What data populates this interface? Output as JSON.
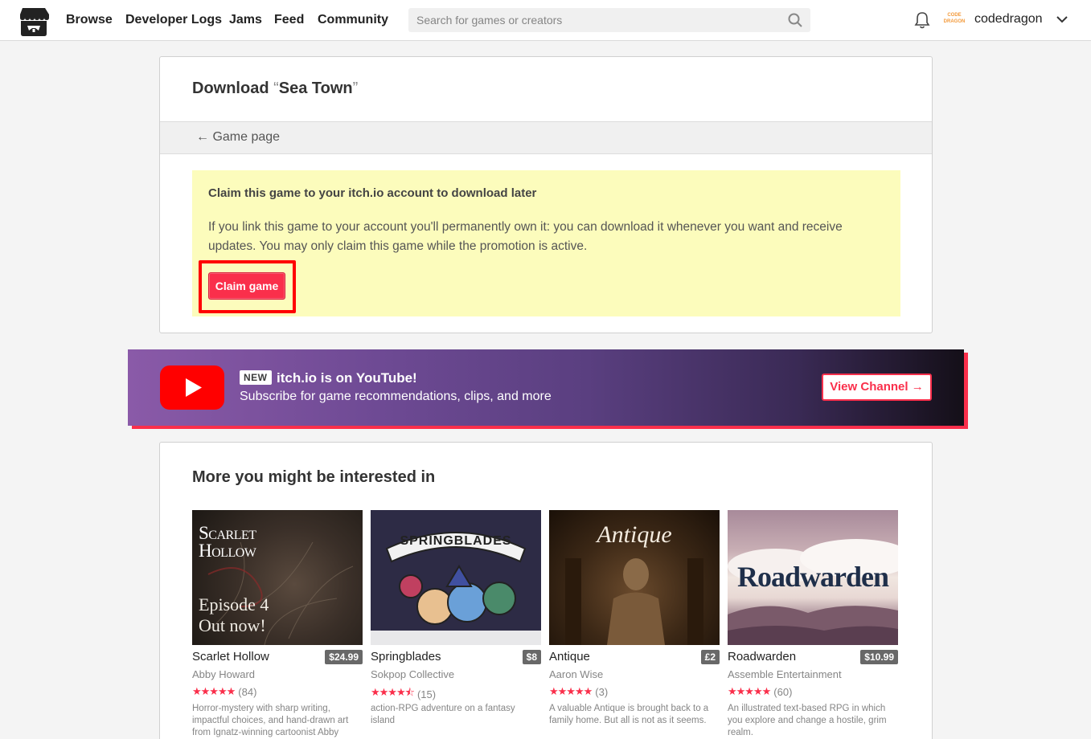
{
  "header": {
    "nav": [
      "Browse",
      "Developer Logs",
      "Jams",
      "Feed",
      "Community"
    ],
    "search_placeholder": "Search for games or creators",
    "avatar_text": "CODE DRAGON",
    "username": "codedragon"
  },
  "download": {
    "title_prefix": "Download ",
    "open_quote": "“",
    "game_name": "Sea Town",
    "close_quote": "”",
    "back_link": "← Game page",
    "claim_title": "Claim this game to your itch.io account to download later",
    "claim_desc": "If you link this game to your account you'll permanently own it: you can download it whenever you want and receive updates. You may only claim this game while the promotion is active.",
    "claim_button": "Claim game"
  },
  "youtube_banner": {
    "badge": "NEW",
    "title": "itch.io is on YouTube!",
    "subtitle": "Subscribe for game recommendations, clips, and more",
    "button": "View Channel →"
  },
  "recommendations": {
    "heading": "More you might be interested in",
    "games": [
      {
        "title": "Scarlet Hollow",
        "price": "$24.99",
        "author": "Abby Howard",
        "stars": "★★★★★",
        "rating_count": "(84)",
        "desc": "Horror-mystery with sharp writing, impactful choices, and hand-drawn art from Ignatz-winning cartoonist Abby",
        "thumb_title": "Scarlet Hollow",
        "thumb_sub": "Episode 4 Out now!"
      },
      {
        "title": "Springblades",
        "price": "$8",
        "author": "Sokpop Collective",
        "stars": "★★★★⯪",
        "rating_count": "(15)",
        "desc": "action-RPG adventure on a fantasy island",
        "thumb_title": "SPRINGBLADES",
        "thumb_sub": ""
      },
      {
        "title": "Antique",
        "price": "£2",
        "author": "Aaron Wise",
        "stars": "★★★★★",
        "rating_count": "(3)",
        "desc": "A valuable Antique is brought back to a family home. But all is not as it seems.",
        "thumb_title": "Antique",
        "thumb_sub": ""
      },
      {
        "title": "Roadwarden",
        "price": "$10.99",
        "author": "Assemble Entertainment",
        "stars": "★★★★★",
        "rating_count": "(60)",
        "desc": "An illustrated text-based RPG in which you explore and change a hostile, grim realm.",
        "thumb_title": "Roadwarden",
        "thumb_sub": ""
      }
    ]
  },
  "colors": {
    "accent": "#fa2f4b",
    "claim_bg": "#fcfcbc",
    "highlight": "#ff0000"
  }
}
